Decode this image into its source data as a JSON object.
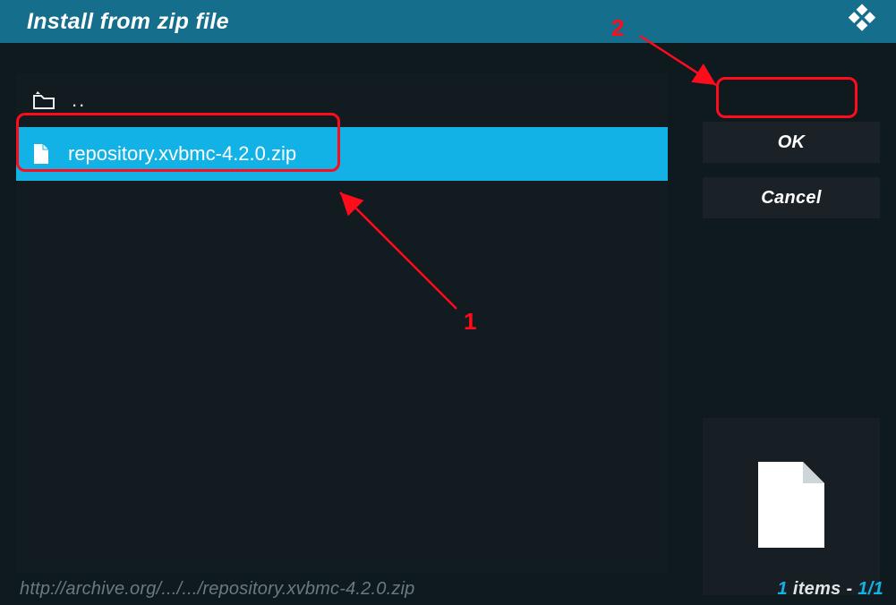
{
  "title": "Install from zip file",
  "file_list": {
    "parent_label": "..",
    "items": [
      {
        "name": "repository.xvbmc-4.2.0.zip",
        "selected": true
      }
    ]
  },
  "buttons": {
    "ok": "OK",
    "cancel": "Cancel"
  },
  "status": {
    "path": "http://archive.org/.../.../repository.xvbmc-4.2.0.zip",
    "count_current": "1",
    "count_label_mid": " items - ",
    "page_current": "1",
    "page_sep": "/",
    "page_total": "1"
  },
  "annotations": {
    "label1": "1",
    "label2": "2"
  },
  "colors": {
    "accent": "#12b2e7",
    "titlebar": "#146e8c",
    "panel_dark": "#0f1a1f",
    "button_bg": "#1a2228",
    "annotation_red": "#ff0c1c"
  }
}
